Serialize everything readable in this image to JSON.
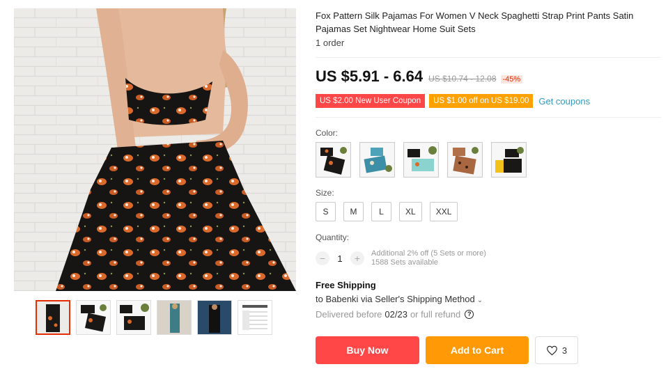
{
  "product": {
    "title": "Fox Pattern Silk Pajamas For Women V Neck Spaghetti Strap Print Pants Satin Pajamas Set Nightwear Home Suit Sets",
    "orders": "1 order"
  },
  "price": {
    "current": "US $5.91 - 6.64",
    "original": "US $10.74 - 12.08",
    "discount": "-45%"
  },
  "coupons": {
    "new_user": "US $2.00 New User Coupon",
    "store": "US $1.00 off on US $19.00",
    "link": "Get coupons"
  },
  "color": {
    "label": "Color:",
    "options": [
      "black-fox-crop-set",
      "blue-floral-set",
      "mint-fox-set",
      "leopard-brown-set",
      "black-yellow-set"
    ]
  },
  "size": {
    "label": "Size:",
    "options": [
      "S",
      "M",
      "L",
      "XL",
      "XXL"
    ]
  },
  "quantity": {
    "label": "Quantity:",
    "value": "1",
    "note1": "Additional 2% off (5 Sets or more)",
    "note2": "1588 Sets available"
  },
  "shipping": {
    "title": "Free Shipping",
    "to": "to Babenki via Seller's Shipping Method",
    "delivered_prefix": "Delivered before",
    "delivered_date": "02/23",
    "delivered_suffix": "or full refund"
  },
  "actions": {
    "buy": "Buy Now",
    "cart": "Add to Cart",
    "wishlist_count": "3"
  },
  "colors": {
    "red": "#ff4747",
    "orange": "#ff9a06",
    "link": "#2e9cc3"
  }
}
